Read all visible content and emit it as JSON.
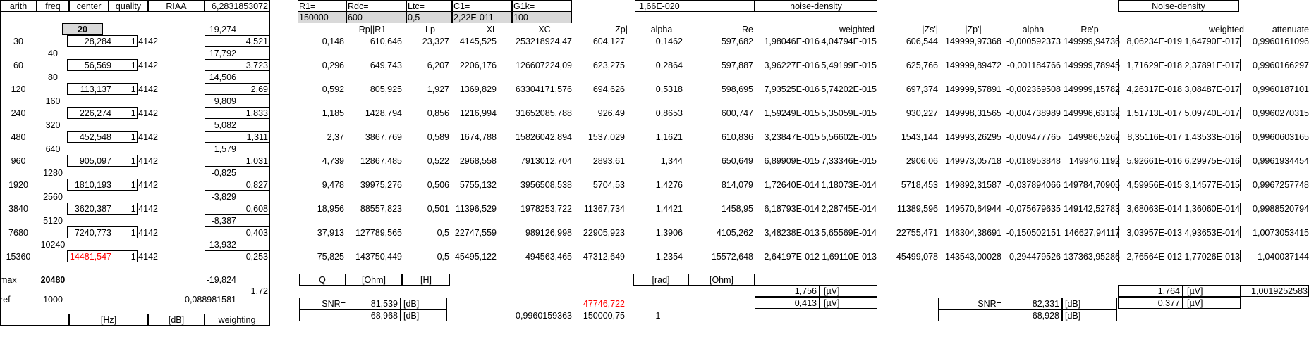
{
  "sheet": {
    "headers": {
      "arith": "arith",
      "freq": "freq",
      "center": "center",
      "quality": "quality",
      "riaa": "RIAA",
      "twopi": "6,2831853072",
      "r1_label": "R1=",
      "rdc_label": "Rdc=",
      "ltc_label": "Ltc=",
      "c1_label": "C1=",
      "g1k_label": "G1k=",
      "r1_value": "150000",
      "rdc_value": "600",
      "ltc_value": "0,5",
      "c1_value": "2,22E-011",
      "g1k_value": "100",
      "k_value": "1,66E-020",
      "noise_density": "noise-density",
      "noise_density2": "Noise-density",
      "col_rp": "Rp||R1",
      "col_lp": "Lp",
      "col_xl": "XL",
      "col_xc": "XC",
      "col_zp": "|Zp|",
      "col_alpha": "alpha",
      "col_re": "Re",
      "col_weighted": "weighted",
      "col_zs2": "|Zs'|",
      "col_zp2": "|Zp'|",
      "col_alpha2": "alpha",
      "col_rep2": "Re'p",
      "col_weighted2": "weighted",
      "col_attenuate": "attenuate"
    },
    "left": {
      "freq_first": "20",
      "arith": [
        "30",
        "60",
        "120",
        "240",
        "480",
        "960",
        "1920",
        "3840",
        "7680",
        "15360"
      ],
      "freq_mid": [
        "40",
        "80",
        "160",
        "320",
        "640",
        "1280",
        "2560",
        "5120",
        "10240"
      ],
      "center": [
        "28,284",
        "56,569",
        "113,137",
        "226,274",
        "452,548",
        "905,097",
        "1810,193",
        "3620,387",
        "7240,773",
        "14481,547"
      ],
      "quality": [
        "1,4142",
        "1,4142",
        "1,4142",
        "1,4142",
        "1,4142",
        "1,4142",
        "1,4142",
        "1,4142",
        "1,4142",
        "1,4142"
      ],
      "riaa": [
        "19,274",
        "17,792",
        "14,506",
        "9,809",
        "5,082",
        "1,579",
        "-0,825",
        "-3,829",
        "-8,387",
        "-13,932",
        "-19,824"
      ],
      "weighting": [
        "4,521",
        "3,723",
        "2,69",
        "1,833",
        "1,311",
        "1,031",
        "0,827",
        "0,608",
        "0,403",
        "0,253"
      ],
      "max_label": "max",
      "max_value": "20480",
      "weight_extra": "1,72",
      "ref_label": "ref",
      "ref_value": "1000",
      "ref_riaa": "0,088981581",
      "unit_hz": "[Hz]",
      "unit_db": "[dB]",
      "unit_weighting": "weighting"
    },
    "rows": [
      {
        "q": "0,148",
        "rp": "610,646",
        "lp": "23,327",
        "xl": "4145,525",
        "xc": "253218924,47",
        "zp": "604,127",
        "alpha": "0,1462",
        "re": "597,682",
        "nd": "1,98046E-016",
        "w": "4,04794E-015",
        "zs2": "606,544",
        "zp2": "149999,97368",
        "a2": "-0,000592373",
        "rep2": "149999,94736",
        "nd2": "8,06234E-019",
        "w2": "1,64790E-017",
        "att": "0,9960161096"
      },
      {
        "q": "0,296",
        "rp": "649,743",
        "lp": "6,207",
        "xl": "2206,176",
        "xc": "126607224,09",
        "zp": "623,275",
        "alpha": "0,2864",
        "re": "597,887",
        "nd": "3,96227E-016",
        "w": "5,49199E-015",
        "zs2": "625,766",
        "zp2": "149999,89472",
        "a2": "-0,001184766",
        "rep2": "149999,78945",
        "nd2": "1,71629E-018",
        "w2": "2,37891E-017",
        "att": "0,9960166297"
      },
      {
        "q": "0,592",
        "rp": "805,925",
        "lp": "1,927",
        "xl": "1369,829",
        "xc": "63304171,576",
        "zp": "694,626",
        "alpha": "0,5318",
        "re": "598,695",
        "nd": "7,93525E-016",
        "w": "5,74202E-015",
        "zs2": "697,374",
        "zp2": "149999,57891",
        "a2": "-0,002369508",
        "rep2": "149999,15782",
        "nd2": "4,26317E-018",
        "w2": "3,08487E-017",
        "att": "0,9960187101"
      },
      {
        "q": "1,185",
        "rp": "1428,794",
        "lp": "0,856",
        "xl": "1216,994",
        "xc": "31652085,788",
        "zp": "926,49",
        "alpha": "0,8653",
        "re": "600,747",
        "nd": "1,59249E-015",
        "w": "5,35059E-015",
        "zs2": "930,227",
        "zp2": "149998,31565",
        "a2": "-0,004738989",
        "rep2": "149996,63132",
        "nd2": "1,51713E-017",
        "w2": "5,09740E-017",
        "att": "0,9960270315"
      },
      {
        "q": "2,37",
        "rp": "3867,769",
        "lp": "0,589",
        "xl": "1674,788",
        "xc": "15826042,894",
        "zp": "1537,029",
        "alpha": "1,1621",
        "re": "610,836",
        "nd": "3,23847E-015",
        "w": "5,56602E-015",
        "zs2": "1543,144",
        "zp2": "149993,26295",
        "a2": "-0,009477765",
        "rep2": "149986,5262",
        "nd2": "8,35116E-017",
        "w2": "1,43533E-016",
        "att": "0,9960603165"
      },
      {
        "q": "4,739",
        "rp": "12867,485",
        "lp": "0,522",
        "xl": "2968,558",
        "xc": "7913012,704",
        "zp": "2893,61",
        "alpha": "1,344",
        "re": "650,649",
        "nd": "6,89909E-015",
        "w": "7,33346E-015",
        "zs2": "2906,06",
        "zp2": "149973,05718",
        "a2": "-0,018953848",
        "rep2": "149946,1192",
        "nd2": "5,92661E-016",
        "w2": "6,29975E-016",
        "att": "0,9961934454"
      },
      {
        "q": "9,478",
        "rp": "39975,276",
        "lp": "0,506",
        "xl": "5755,132",
        "xc": "3956508,538",
        "zp": "5704,53",
        "alpha": "1,4276",
        "re": "814,079",
        "nd": "1,72640E-014",
        "w": "1,18073E-014",
        "zs2": "5718,453",
        "zp2": "149892,31587",
        "a2": "-0,037894066",
        "rep2": "149784,70905",
        "nd2": "4,59956E-015",
        "w2": "3,14577E-015",
        "att": "0,9967257748"
      },
      {
        "q": "18,956",
        "rp": "88557,823",
        "lp": "0,501",
        "xl": "11396,529",
        "xc": "1978253,722",
        "zp": "11367,734",
        "alpha": "1,4421",
        "re": "1458,95",
        "nd": "6,18793E-014",
        "w": "2,28745E-014",
        "zs2": "11389,596",
        "zp2": "149570,64944",
        "a2": "-0,075679635",
        "rep2": "149142,52783",
        "nd2": "3,68063E-014",
        "w2": "1,36060E-014",
        "att": "0,9988520794"
      },
      {
        "q": "37,913",
        "rp": "127789,565",
        "lp": "0,5",
        "xl": "22747,559",
        "xc": "989126,998",
        "zp": "22905,923",
        "alpha": "1,3906",
        "re": "4105,262",
        "nd": "3,48238E-013",
        "w": "5,65569E-014",
        "zs2": "22755,471",
        "zp2": "148304,38691",
        "a2": "-0,150502151",
        "rep2": "146627,94117",
        "nd2": "3,03957E-013",
        "w2": "4,93653E-014",
        "att": "1,0073053415"
      },
      {
        "q": "75,825",
        "rp": "143750,449",
        "lp": "0,5",
        "xl": "45495,122",
        "xc": "494563,465",
        "zp": "47312,649",
        "alpha": "1,2354",
        "re": "15572,648",
        "nd": "2,64197E-012",
        "w": "1,69110E-013",
        "zs2": "45499,078",
        "zp2": "143543,00028",
        "a2": "-0,294479526",
        "rep2": "137363,95286",
        "nd2": "2,76564E-012",
        "w2": "1,77026E-013",
        "att": "1,040037144"
      }
    ],
    "units": {
      "q": "Q",
      "ohm": "[Ohm]",
      "h": "[H]",
      "rad": "[rad]",
      "ohm2": "[Ohm]"
    },
    "totals": {
      "uv1_a": "1,756",
      "uv1_b": "0,413",
      "uv_unit": "[µV]",
      "uv2_a": "1,764",
      "uv2_b": "0,377",
      "att_total": "1,0019252583"
    },
    "snr": {
      "label": "SNR=",
      "v1": "81,539",
      "v1b": "68,968",
      "db": "[dB]",
      "v2": "82,331",
      "v2b": "68,928",
      "red_value": "47746,722",
      "bottom_a": "0,9960159363",
      "bottom_b": "150000,75",
      "bottom_c": "1"
    }
  }
}
